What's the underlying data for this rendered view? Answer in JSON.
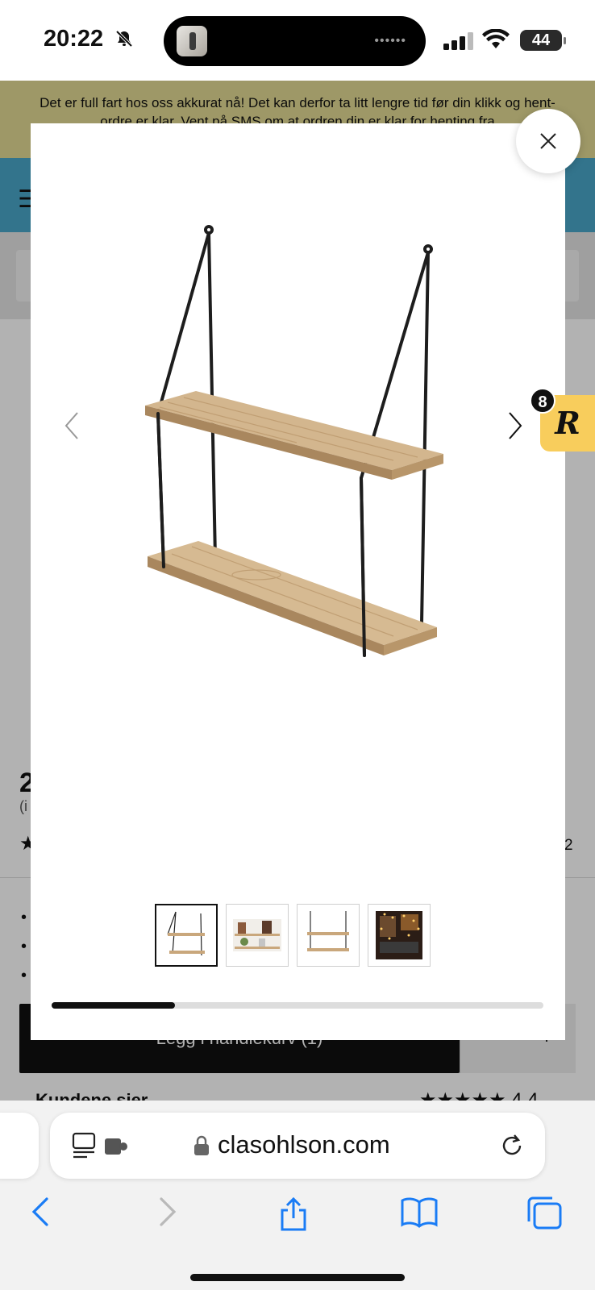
{
  "status_bar": {
    "time": "20:22",
    "battery": "44",
    "icons": [
      "bell-slash-icon",
      "signal-icon",
      "wifi-icon",
      "battery-icon"
    ]
  },
  "background_page": {
    "notice_text": "Det er full fart hos oss akkurat nå! Det kan derfor ta litt lengre tid før din klikk og hent-ordre er klar. Vent på SMS om at ordren din er klar for henting fra",
    "price_fragment": "2",
    "inkl_fragment": "(i",
    "rating_count_fragment": "2",
    "bullets": [
      "•",
      "•",
      "•"
    ],
    "add_to_cart_label": "Legg i handlekurv (1)",
    "qty_minus": "-",
    "qty_plus": "+",
    "reviews_label": "Kundene sier",
    "reviews_stars": "★★★★★ 4.4"
  },
  "gallery": {
    "thumbnails": [
      {
        "name": "thumb-shelf-front"
      },
      {
        "name": "thumb-shelf-styled"
      },
      {
        "name": "thumb-shelf-side"
      },
      {
        "name": "thumb-shelf-room"
      }
    ],
    "active_index": 0,
    "progress": 0.25
  },
  "side_widget": {
    "letter": "R",
    "badge_count": "8"
  },
  "safari": {
    "url": "clasohlson.com",
    "icons": [
      "reader-icon",
      "extension-icon",
      "lock-icon",
      "reload-icon",
      "back-icon",
      "forward-icon",
      "share-icon",
      "bookmarks-icon",
      "tabs-icon"
    ]
  },
  "colors": {
    "notice_bg": "#e3da94",
    "header_bg": "#4aa7c9",
    "widget_bg": "#f8cd5c",
    "safari_accent": "#1a7cf5"
  }
}
